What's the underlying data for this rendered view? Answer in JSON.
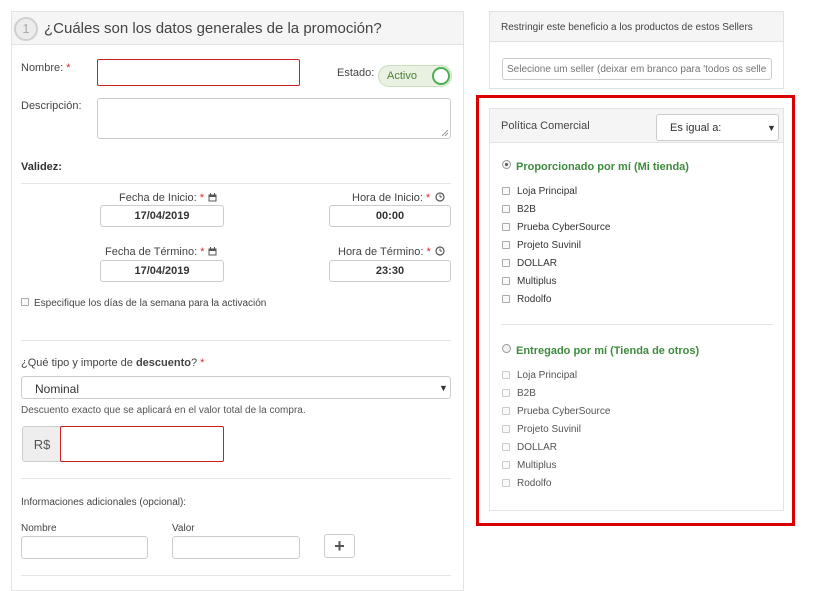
{
  "section": {
    "step_number": "1",
    "title": "¿Cuáles son los datos generales de la promoción?"
  },
  "form": {
    "name_label": "Nombre:",
    "required_mark": "*",
    "name_value": "",
    "status_label": "Estado:",
    "status_toggle_text": "Activo",
    "status_active": true,
    "description_label": "Descripción:",
    "description_value": "",
    "validity_title": "Validez:",
    "start_date_label": "Fecha de Inicio:",
    "start_date_value": "17/04/2019",
    "start_time_label": "Hora de Inicio:",
    "start_time_value": "00:00",
    "end_date_label": "Fecha de Término:",
    "end_date_value": "17/04/2019",
    "end_time_label": "Hora de Término:",
    "end_time_value": "23:30",
    "weekdays_checkbox_label": "Especifique los días de la semana para la activación",
    "weekdays_checked": false,
    "discount_question_prefix": "¿Qué tipo y importe de ",
    "discount_question_bold": "descuento",
    "discount_question_suffix": "?",
    "discount_type_value": "Nominal",
    "discount_help": "Descuento exacto que se aplicará en el valor total de la compra.",
    "currency_symbol": "R$",
    "discount_amount_value": "",
    "additional_info_label": "Informaciones adicionales (opcional):",
    "additional_name_label": "Nombre",
    "additional_value_label": "Valor",
    "additional_name_value": "",
    "additional_value_value": "",
    "add_button_label": "+"
  },
  "sellers": {
    "title": "Restringir este beneficio a los productos de estos Sellers",
    "placeholder": "Selecione um seller (deixar em branco para 'todos os sellers')"
  },
  "policy": {
    "title": "Política Comercial",
    "operator_value": "Es igual a:",
    "option_own": {
      "label": "Proporcionado por mí (Mi tienda)",
      "selected": true,
      "items": [
        "Loja Principal",
        "B2B",
        "Prueba CyberSource",
        "Projeto Suvinil",
        "DOLLAR",
        "Multiplus",
        "Rodolfo"
      ]
    },
    "option_others": {
      "label": "Entregado por mí (Tienda de otros)",
      "selected": false,
      "items": [
        "Loja Principal",
        "B2B",
        "Prueba CyberSource",
        "Projeto Suvinil",
        "DOLLAR",
        "Multiplus",
        "Rodolfo"
      ]
    }
  },
  "colors": {
    "accent_green": "#3d8b3d",
    "error_red": "#cc1f1f",
    "highlight_red": "#d90000"
  }
}
